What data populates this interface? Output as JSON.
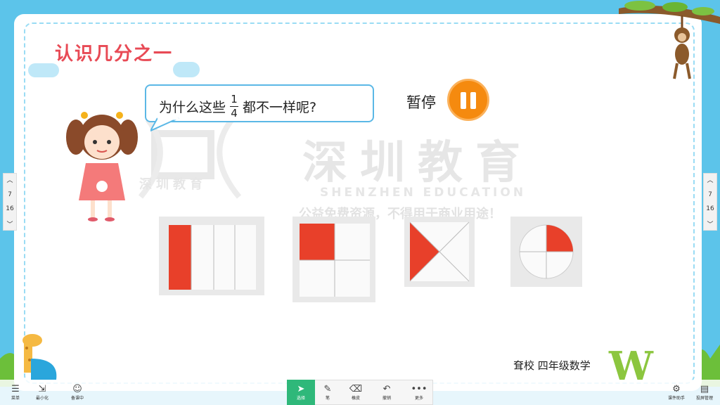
{
  "slide": {
    "title": "认识几分之一",
    "question_before": "为什么这些",
    "fraction": {
      "numerator": "1",
      "denominator": "4"
    },
    "question_after": "都不一样呢?",
    "pause_label": "暂停",
    "watermark_main": "深圳教育",
    "watermark_en": "SHENZHEN EDUCATION",
    "watermark_notice": "公益免费资源，不得用于商业用途！",
    "watermark_logo_text": "深圳教育",
    "footer": "耷校 四年级数学",
    "corner_letter": "W"
  },
  "pager": {
    "current": "7",
    "total": "16"
  },
  "toolbar": {
    "left": [
      {
        "label": "菜单",
        "icon": "menu-icon"
      },
      {
        "label": "最小化",
        "icon": "minimize-icon"
      },
      {
        "label": "备课中",
        "icon": "avatar-icon"
      }
    ],
    "center": [
      {
        "label": "选择",
        "icon": "cursor-icon"
      },
      {
        "label": "笔",
        "icon": "pen-icon"
      },
      {
        "label": "橡皮",
        "icon": "eraser-icon"
      },
      {
        "label": "撤销",
        "icon": "undo-icon"
      },
      {
        "label": "更多",
        "icon": "more-icon"
      }
    ],
    "right": [
      {
        "label": "课件助手",
        "icon": "assistant-icon"
      },
      {
        "label": "投屏管理",
        "icon": "cast-icon"
      }
    ]
  },
  "colors": {
    "sky": "#5cc4ea",
    "accent_red": "#e84a55",
    "pause_orange": "#f58a0f",
    "paper_red": "#e8402a",
    "toolbar_green": "#2fb87a"
  }
}
